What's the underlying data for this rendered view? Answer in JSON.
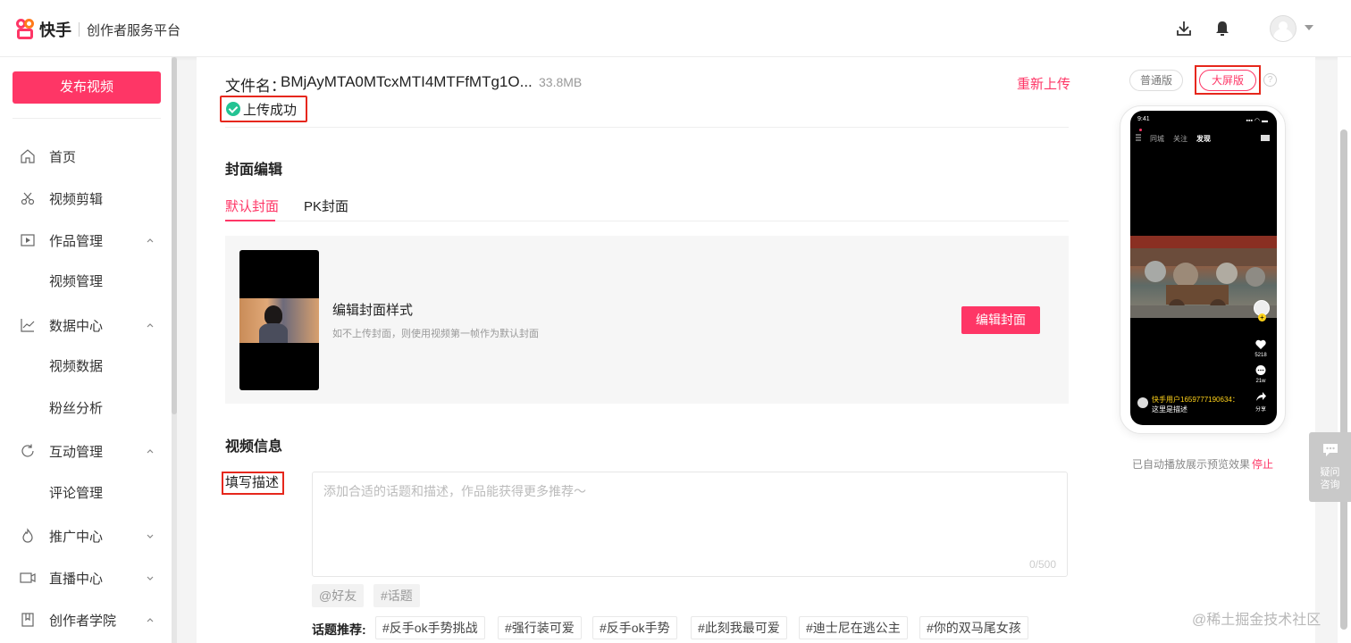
{
  "header": {
    "brand": "快手",
    "platform": "创作者服务平台",
    "icons": [
      "download-icon",
      "bell-icon",
      "avatar"
    ]
  },
  "sidebar": {
    "publish_button": "发布视频",
    "items": [
      {
        "label": "首页",
        "icon": "home-icon"
      },
      {
        "label": "视频剪辑",
        "icon": "scissors-icon"
      },
      {
        "label": "作品管理",
        "icon": "play-square-icon",
        "expanded": true
      },
      {
        "label": "视频管理",
        "sub": true
      },
      {
        "label": "数据中心",
        "icon": "chart-icon",
        "expanded": true
      },
      {
        "label": "视频数据",
        "sub": true
      },
      {
        "label": "粉丝分析",
        "sub": true
      },
      {
        "label": "互动管理",
        "icon": "refresh-icon",
        "expanded": true
      },
      {
        "label": "评论管理",
        "sub": true
      },
      {
        "label": "推广中心",
        "icon": "flame-icon",
        "expanded": false
      },
      {
        "label": "直播中心",
        "icon": "camera-icon",
        "expanded": false
      },
      {
        "label": "创作者学院",
        "icon": "book-icon",
        "expanded": true
      }
    ]
  },
  "upload": {
    "file_label": "文件名：",
    "file_name": "BMjAyMTA0MTcxMTI4MTFfMTg1O...",
    "file_size": "33.8MB",
    "reupload": "重新上传",
    "status": "上传成功"
  },
  "cover": {
    "section_title": "封面编辑",
    "tabs": [
      "默认封面",
      "PK封面"
    ],
    "title": "编辑封面样式",
    "hint": "如不上传封面，则使用视频第一帧作为默认封面",
    "edit_button": "编辑封面"
  },
  "info": {
    "section_title": "视频信息",
    "desc_label": "填写描述",
    "desc_placeholder": "添加合适的话题和描述，作品能获得更多推荐～",
    "desc_count": "0/500",
    "chips": [
      "@好友",
      "#话题"
    ],
    "topic_label": "话题推荐:",
    "topics": [
      "#反手ok手势挑战",
      "#强行装可爱",
      "#反手ok手势",
      "#此刻我最可爱",
      "#迪士尼在逃公主",
      "#你的双马尾女孩"
    ]
  },
  "preview": {
    "tab_normal": "普通版",
    "tab_big": "大屏版",
    "help": "?",
    "phone": {
      "time": "9:41",
      "status_right": "▪▪▪ ◠ ▬",
      "tabs": [
        "同城",
        "关注",
        "发现"
      ],
      "active_tab": "发现",
      "likes": "5218",
      "comments": "21w",
      "share": "分享",
      "username": "快手用户1659777190634：",
      "desc": "这里是描述"
    },
    "autoplay_text": "已自动播放展示预览效果",
    "autoplay_stop": "停止"
  },
  "help_float": {
    "line1": "疑问",
    "line2": "咨询"
  },
  "watermark": "@稀土掘金技术社区",
  "colors": {
    "accent": "#fe3666",
    "success": "#23c393",
    "highlight_box": "#e6271c"
  }
}
